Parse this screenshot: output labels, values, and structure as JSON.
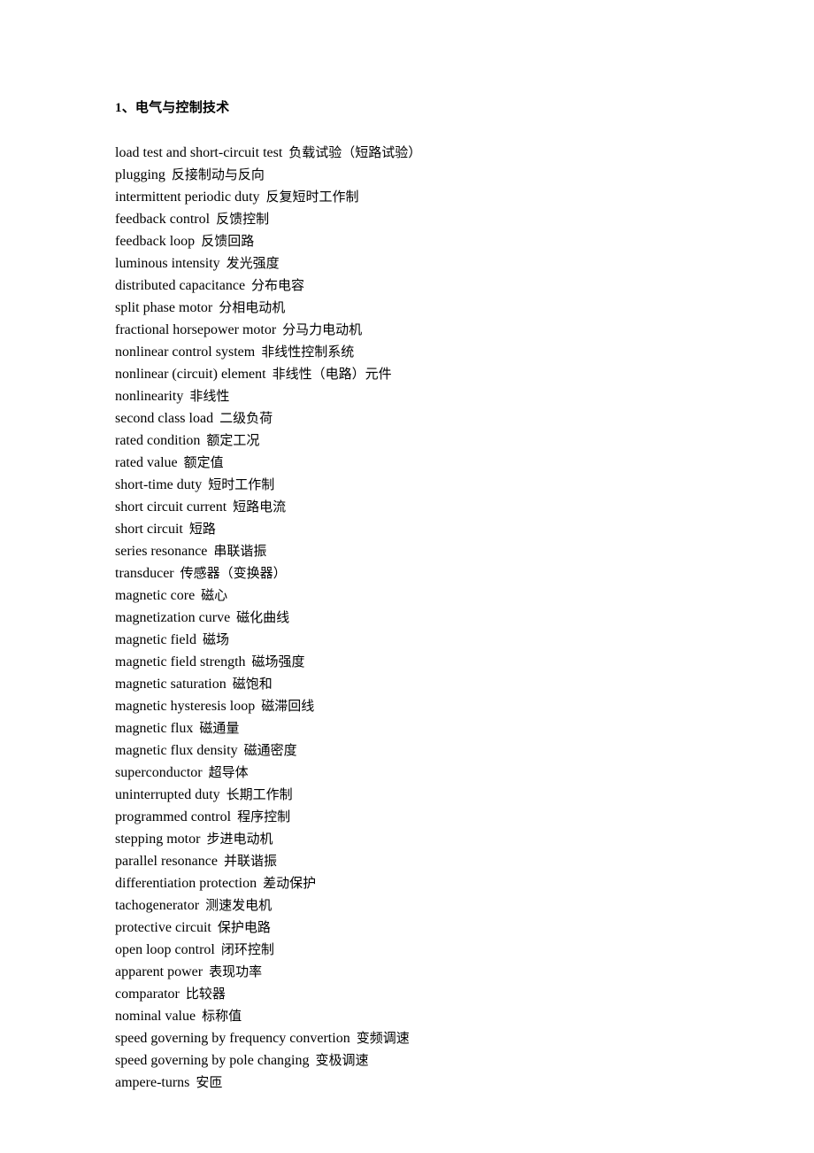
{
  "document": {
    "heading": "1、电气与控制技术",
    "entries": [
      {
        "en": "load test and short-circuit test",
        "cn": "负载试验（短路试验）"
      },
      {
        "en": "plugging",
        "cn": "反接制动与反向"
      },
      {
        "en": "intermittent periodic duty",
        "cn": "反复短时工作制"
      },
      {
        "en": "feedback control",
        "cn": "反馈控制"
      },
      {
        "en": "feedback loop",
        "cn": "反馈回路"
      },
      {
        "en": "luminous intensity",
        "cn": "发光强度"
      },
      {
        "en": "distributed capacitance",
        "cn": "分布电容"
      },
      {
        "en": "split phase motor",
        "cn": "分相电动机"
      },
      {
        "en": "fractional horsepower motor",
        "cn": "分马力电动机"
      },
      {
        "en": "nonlinear control system",
        "cn": "非线性控制系统"
      },
      {
        "en": "nonlinear (circuit) element",
        "cn": "非线性（电路）元件"
      },
      {
        "en": "nonlinearity",
        "cn": "非线性"
      },
      {
        "en": "second class load",
        "cn": "二级负荷"
      },
      {
        "en": "rated condition",
        "cn": "额定工况"
      },
      {
        "en": "rated value",
        "cn": "额定值"
      },
      {
        "en": "short-time duty",
        "cn": "短时工作制"
      },
      {
        "en": "short circuit current",
        "cn": "短路电流"
      },
      {
        "en": "short circuit",
        "cn": "短路"
      },
      {
        "en": "series resonance",
        "cn": "串联谐振"
      },
      {
        "en": "transducer",
        "cn": "传感器（变换器）"
      },
      {
        "en": "magnetic core",
        "cn": "磁心"
      },
      {
        "en": "magnetization curve",
        "cn": "磁化曲线"
      },
      {
        "en": "magnetic field",
        "cn": "磁场"
      },
      {
        "en": "magnetic field strength",
        "cn": "磁场强度"
      },
      {
        "en": "magnetic saturation",
        "cn": "磁饱和"
      },
      {
        "en": "magnetic hysteresis loop",
        "cn": "磁滞回线"
      },
      {
        "en": "magnetic flux",
        "cn": "磁通量"
      },
      {
        "en": "magnetic flux density",
        "cn": "磁通密度"
      },
      {
        "en": "superconductor",
        "cn": "超导体"
      },
      {
        "en": "uninterrupted duty",
        "cn": "长期工作制"
      },
      {
        "en": "programmed control",
        "cn": "程序控制"
      },
      {
        "en": "stepping motor",
        "cn": "步进电动机"
      },
      {
        "en": "parallel resonance",
        "cn": "并联谐振"
      },
      {
        "en": "differentiation protection",
        "cn": "差动保护"
      },
      {
        "en": "tachogenerator",
        "cn": "测速发电机"
      },
      {
        "en": "protective circuit",
        "cn": "保护电路"
      },
      {
        "en": "open loop control",
        "cn": "闭环控制"
      },
      {
        "en": "apparent power",
        "cn": "表现功率"
      },
      {
        "en": "comparator",
        "cn": "比较器"
      },
      {
        "en": "nominal value",
        "cn": "标称值"
      },
      {
        "en": "speed governing by frequency convertion",
        "cn": "变频调速"
      },
      {
        "en": "speed governing by pole changing",
        "cn": "变极调速"
      },
      {
        "en": "ampere-turns",
        "cn": "安匝"
      }
    ]
  }
}
